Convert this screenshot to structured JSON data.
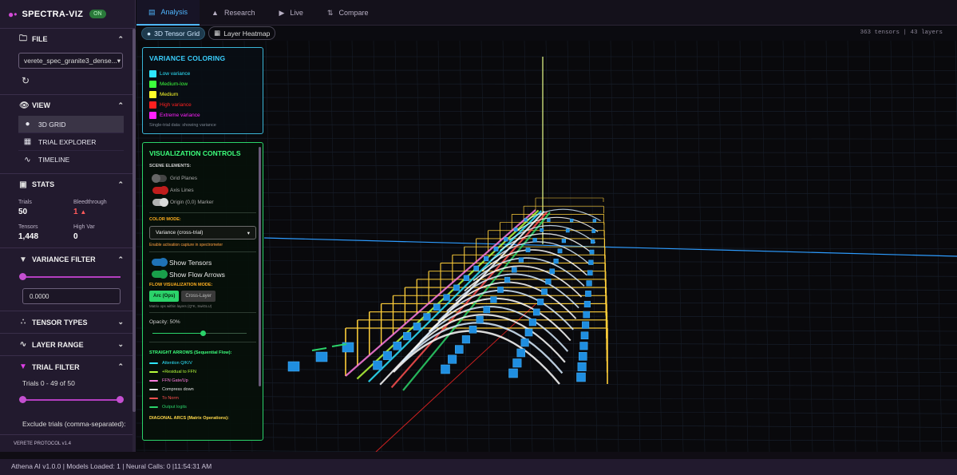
{
  "app": {
    "name": "SPECTRA-VIZ",
    "status_badge": "ON",
    "footer": "VERETE PROTOCOL v1.4"
  },
  "sidebar": {
    "file": {
      "label": "FILE",
      "selected_file": "verete_spec_granite3_dense..."
    },
    "view": {
      "label": "VIEW",
      "items": [
        {
          "label": "3D GRID",
          "icon": "cube-icon",
          "active": true
        },
        {
          "label": "TRIAL EXPLORER",
          "icon": "table-icon",
          "active": false
        },
        {
          "label": "TIMELINE",
          "icon": "chart-line-icon",
          "active": false
        }
      ]
    },
    "stats": {
      "label": "STATS",
      "trials_label": "Trials",
      "trials_value": "50",
      "bleed_label": "Bleedthrough",
      "bleed_value": "1",
      "tensors_label": "Tensors",
      "tensors_value": "1,448",
      "highvar_label": "High Var",
      "highvar_value": "0"
    },
    "variance_filter": {
      "label": "VARIANCE FILTER",
      "value": "0.0000",
      "slider_fraction": 0
    },
    "tensor_types": {
      "label": "TENSOR TYPES"
    },
    "layer_range": {
      "label": "LAYER RANGE"
    },
    "trial_filter": {
      "label": "TRIAL FILTER",
      "range_text": "Trials 0 - 49 of 50",
      "range_min_fraction": 0,
      "range_max_fraction": 1,
      "exclude_label": "Exclude trials (comma-separated):"
    }
  },
  "tabs": [
    {
      "label": "Analysis",
      "icon": "chart-box-icon",
      "active": true
    },
    {
      "label": "Research",
      "icon": "flask-icon",
      "active": false
    },
    {
      "label": "Live",
      "icon": "play-circle-icon",
      "active": false
    },
    {
      "label": "Compare",
      "icon": "compare-icon",
      "active": false
    }
  ],
  "subtabs": [
    {
      "label": "3D Tensor Grid",
      "active": true
    },
    {
      "label": "Layer Heatmap",
      "active": false
    }
  ],
  "tensor_count": "363 tensors | 43 layers",
  "variance_panel": {
    "title": "VARIANCE COLORING",
    "items": [
      {
        "label": "Low variance",
        "color": "#2ee6ff"
      },
      {
        "label": "Medium-low",
        "color": "#3cff3c"
      },
      {
        "label": "Medium",
        "color": "#ffff2a"
      },
      {
        "label": "High variance",
        "color": "#ff2020"
      },
      {
        "label": "Extreme variance",
        "color": "#ff20ff"
      }
    ],
    "note": "Single-trial data: showing variance"
  },
  "controls": {
    "title": "VISUALIZATION CONTROLS",
    "scene_label": "SCENE ELEMENTS:",
    "scene_toggles": [
      {
        "label": "Grid Planes",
        "on": false,
        "color": "#555555"
      },
      {
        "label": "Axis Lines",
        "on": true,
        "color": "#e02020"
      },
      {
        "label": "Origin (0,0) Marker",
        "on": true,
        "color": "#cfcfcf"
      }
    ],
    "color_mode_label": "COLOR MODE:",
    "color_mode_value": "Variance (cross-trial)",
    "color_mode_note": "Enable activation capture in spectrometer",
    "toggles": [
      {
        "label": "Show Tensors",
        "on": true,
        "color": "#2a9cff"
      },
      {
        "label": "Show Flow Arrows",
        "on": true,
        "color": "#22dd66"
      }
    ],
    "flow_mode_label": "FLOW VISUALIZATION MODE:",
    "flow_buttons": [
      {
        "label": "Arc (Ops)",
        "active": true
      },
      {
        "label": "Cross-Layer",
        "active": false
      }
    ],
    "flow_note": "Matrix ops within layers (Q*K, SwiGLU)",
    "opacity_label": "Opacity: 50%",
    "opacity_fraction": 0.5,
    "straight_title": "STRAIGHT ARROWS (Sequential Flow):",
    "straight_items": [
      {
        "label": "Attention Q/K/V",
        "color": "#2ee6ff"
      },
      {
        "label": "+Residual to FFN",
        "color": "#b8ff3c"
      },
      {
        "label": "FFN Gate/Up",
        "color": "#ff7ce0"
      },
      {
        "label": "Compress down",
        "color": "#e0e0e0"
      },
      {
        "label": "To Norm",
        "color": "#ff5050"
      },
      {
        "label": "Output logits",
        "color": "#2bd36a"
      }
    ],
    "diag_title": "DIAGONAL ARCS (Matrix Operations):"
  },
  "statusbar": "Athena AI v1.0.0 | Models Loaded: 1 | Neural Calls: 0 |11:54:31 AM"
}
